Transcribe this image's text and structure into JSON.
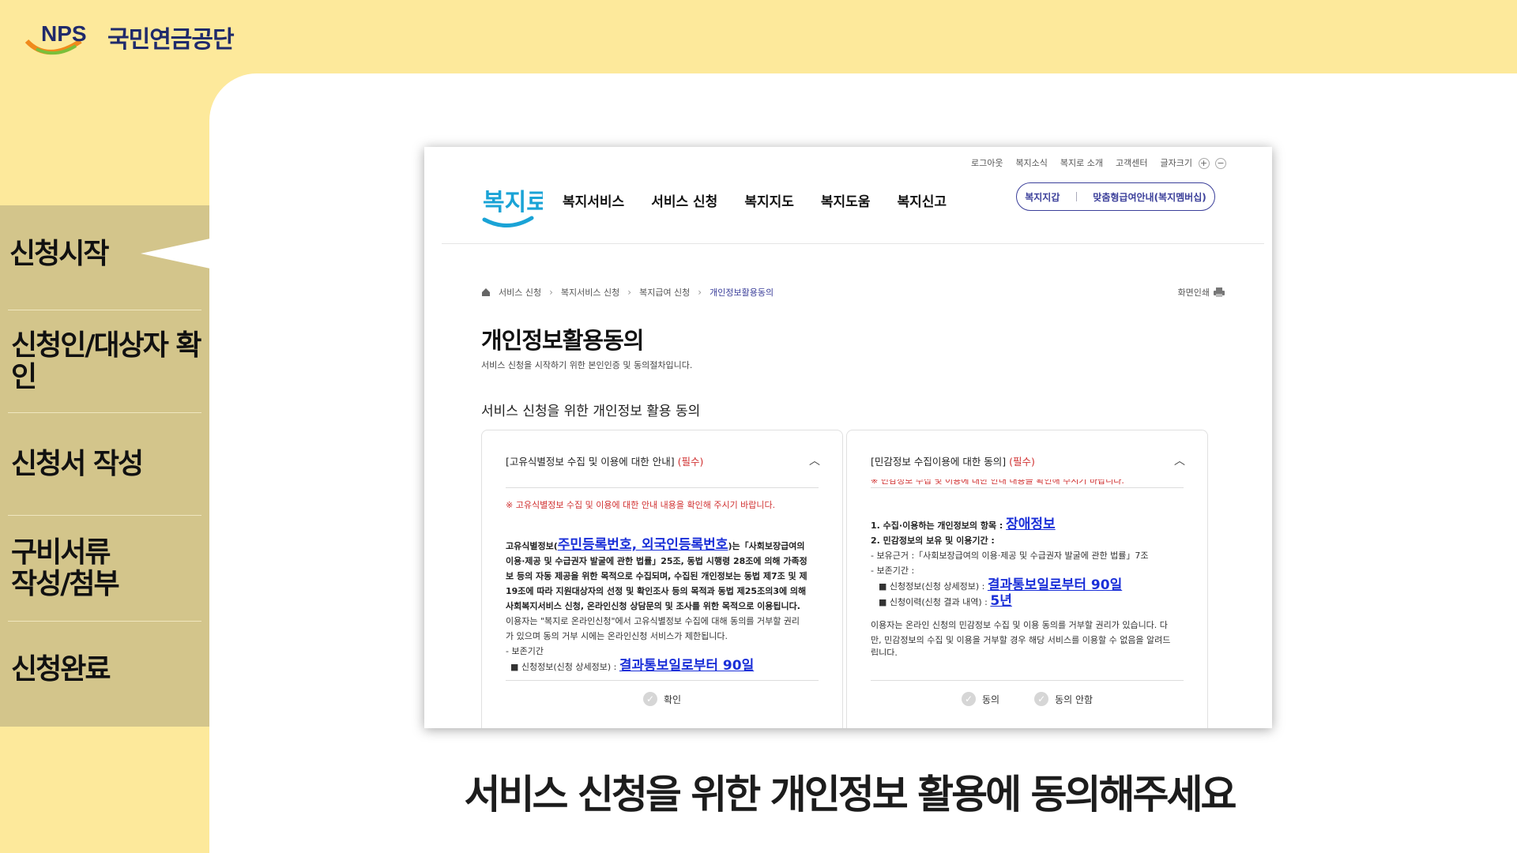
{
  "nps": {
    "logo_text": "NPS",
    "org_name": "국민연금공단"
  },
  "steps": [
    {
      "label": "신청시작"
    },
    {
      "label": "신청인/대상자 확인"
    },
    {
      "label": "신청서 작성"
    },
    {
      "label": "구비서류 작성/첨부"
    },
    {
      "label": "신청완료"
    }
  ],
  "site": {
    "logo_text": "복지로",
    "util": [
      "로그아웃",
      "복지소식",
      "복지로 소개",
      "고객센터",
      "글자크기"
    ],
    "util_plus": "+",
    "util_minus": "−",
    "nav": [
      "복지서비스",
      "서비스 신청",
      "복지지도",
      "복지도움",
      "복지신고"
    ],
    "pill": [
      "복지지갑",
      "맞춤형급여안내(복지멤버십)"
    ]
  },
  "breadcrumb": [
    "서비스 신청",
    "복지서비스 신청",
    "복지급여 신청",
    "개인정보활용동의"
  ],
  "print_label": "화면인쇄",
  "page": {
    "title": "개인정보활용동의",
    "subtitle": "서비스 신청을 시작하기 위한 본인인증 및 동의절차입니다.",
    "section_title": "서비스 신청을 위한 개인정보 활용 동의"
  },
  "card_left": {
    "title": "[고유식별정보 수집 및 이용에 대한 안내]",
    "required": "(필수)",
    "notice": "※ 고유식별정보 수집 및 이용에 대한 안내 내용을 확인해 주시기 바랍니다.",
    "p1_prefix": "고유식별정보(",
    "p1_link": "주민등록번호, 외국인등록번호",
    "p1_suffix": ")는「사회보장급여의",
    "p1_line2": "이용·제공 및 수급권자 발굴에 관한 법률」25조, 동법 시행령 28조에 의해 가족정",
    "p1_line3": "보 등의 자동 제공을 위한 목적으로 수집되며, 수집된 개인정보는 동법 제7조 및 제",
    "p1_line4": "19조에 따라 지원대상자의 선정 및 확인조사 등의 목적과 동법 제25조의3에 의해",
    "p1_line5": "사회복지서비스 신청, 온라인신청 상담문의 및 조사를 위한 목적으로 이용됩니다.",
    "p2_line1": "이용자는 \"복지로 온라인신청\"에서 고유식별정보 수집에 대해 동의를 거부할 권리",
    "p2_line2": "가 있으며 동의 거부 시에는 온라인신청 서비스가 제한됩니다.",
    "retention_label": "- 보존기간",
    "retention_item": "■ 신청정보(신청 상세정보) :",
    "retention_value": "결과통보일로부터 90일",
    "confirm_label": "확인"
  },
  "card_right": {
    "title": "[민감정보 수집이용에 대한 동의]",
    "required": "(필수)",
    "cut_notice": "※ 민감정보 수집 및 이용에 대한 안내 내용을 확인해 주시기 바랍니다.",
    "item1_label": "1. 수집·이용하는 개인정보의 항목 :",
    "item1_value": "장애정보",
    "item2_label": "2. 민감정보의 보유 및 이용기간 :",
    "basis": "- 보유근거 :「사회보장급여의 이용·제공 및 수급권자 발굴에 관한 법률」7조",
    "period_label": "- 보존기간 :",
    "period1_label": "■ 신청정보(신청 상세정보) :",
    "period1_value": "결과통보일로부터 90일",
    "period2_label": "■ 신청이력(신청 결과 내역) :",
    "period2_value": "5년",
    "refuse_text1": "이용자는 온라인 신청의 민감정보 수집 및 이용 동의를 거부할 권리가 있습니다. 다",
    "refuse_text2": "만, 민감정보의 수집 및 이용을 거부할 경우 해당 서비스를 이용할 수 없음을 알려드",
    "refuse_text3": "립니다.",
    "agree_label": "동의",
    "disagree_label": "동의 안함"
  },
  "caption": "서비스 신청을 위한 개인정보 활용에 동의해주세요",
  "colors": {
    "background": "#fde99b",
    "sidebar": "#d3c58b",
    "accent": "#3b3f9a",
    "link": "#1a2fd8",
    "required": "#d03030"
  }
}
